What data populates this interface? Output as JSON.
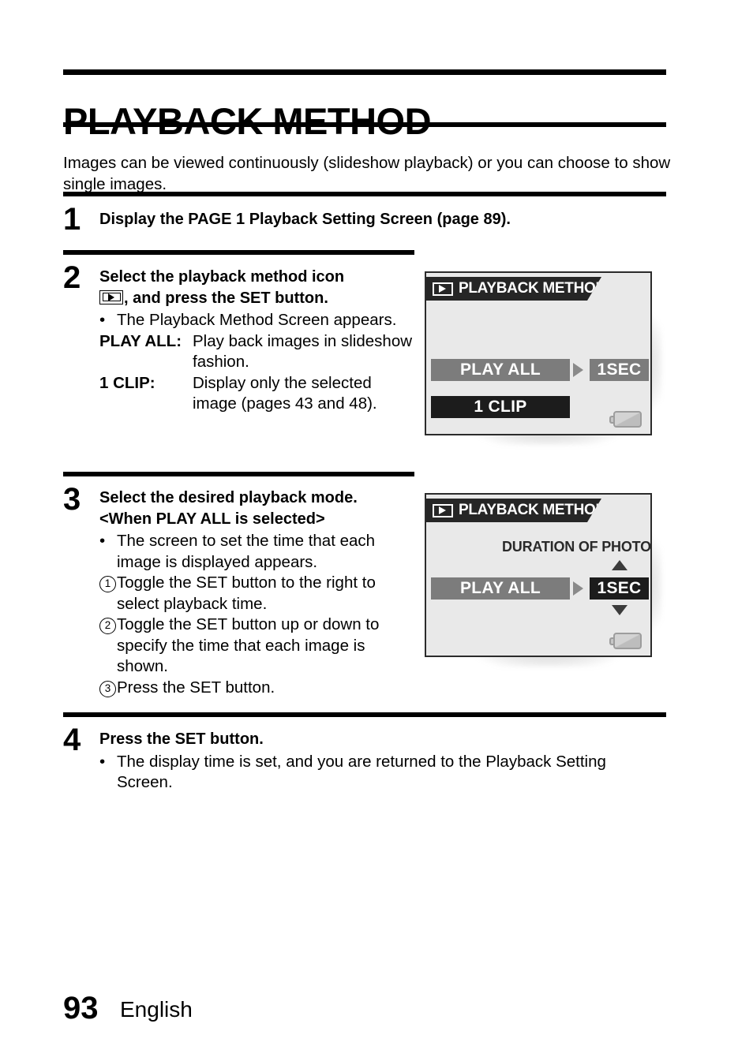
{
  "document": {
    "title": "PLAYBACK METHOD",
    "intro": "Images can be viewed continuously (slideshow playback) or you can choose to show single images."
  },
  "steps": [
    {
      "number": "1",
      "heading": "Display the PAGE 1 Playback Setting Screen (page 89)."
    },
    {
      "number": "2",
      "heading_line1": "Select the playback method icon",
      "heading_line2": ", and press the SET button.",
      "icon_name": "playback-method-icon",
      "bullet": "The Playback Method Screen appears.",
      "definitions": [
        {
          "term": "PLAY ALL:",
          "definition": "Play back images in slideshow fashion."
        },
        {
          "term": "1 CLIP:",
          "definition": "Display only the selected image (pages 43 and 48)."
        }
      ]
    },
    {
      "number": "3",
      "heading_line1": "Select the desired playback mode.",
      "heading_line2": "<When PLAY ALL is selected>",
      "bullet": "The screen to set the time that each image is displayed appears.",
      "substeps": [
        {
          "marker": "1",
          "text": "Toggle the SET button to the right to select playback time."
        },
        {
          "marker": "2",
          "text": "Toggle the SET button up or down to specify the time that each image is shown."
        },
        {
          "marker": "3",
          "text": "Press the SET button."
        }
      ]
    },
    {
      "number": "4",
      "heading": "Press the SET button.",
      "bullet": "The display time is set, and you are returned to the Playback Setting Screen."
    }
  ],
  "screens": [
    {
      "name": "playback-method-screen",
      "header_title": "PLAYBACK METHOD",
      "items": [
        {
          "label": "PLAY ALL",
          "state": "gray"
        },
        {
          "label": "1SEC",
          "state": "gray"
        },
        {
          "label": "1 CLIP",
          "state": "black"
        }
      ],
      "battery_icon": "battery-icon"
    },
    {
      "name": "duration-of-photo-screen",
      "header_title": "PLAYBACK METHOD",
      "label": "DURATION OF PHOTO",
      "items": [
        {
          "label": "PLAY ALL",
          "state": "gray"
        },
        {
          "label": "1SEC",
          "state": "black"
        }
      ],
      "battery_icon": "battery-icon"
    }
  ],
  "footer": {
    "page_number": "93",
    "language": "English"
  },
  "colors": {
    "lcd_background": "#e9e9e9",
    "lcd_header": "#262626",
    "item_gray": "#7c7c7c",
    "item_black": "#1c1c1c"
  }
}
